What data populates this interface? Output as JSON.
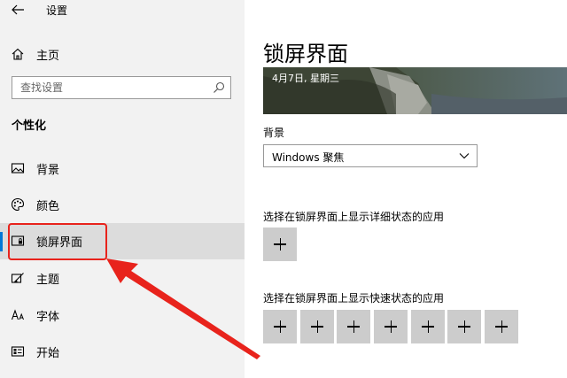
{
  "window": {
    "title": "设置"
  },
  "sidebar": {
    "home_label": "主页",
    "search_placeholder": "查找设置",
    "section_title": "个性化",
    "items": [
      {
        "label": "背景",
        "icon": "image-icon"
      },
      {
        "label": "颜色",
        "icon": "palette-icon"
      },
      {
        "label": "锁屏界面",
        "icon": "lock-screen-icon",
        "active": true
      },
      {
        "label": "主题",
        "icon": "theme-brush-icon"
      },
      {
        "label": "字体",
        "icon": "font-icon"
      },
      {
        "label": "开始",
        "icon": "start-menu-icon"
      }
    ]
  },
  "main": {
    "title": "锁屏界面",
    "preview_date": "4月7日, 星期三",
    "background_label": "背景",
    "background_value": "Windows 聚焦",
    "detail_label": "选择在锁屏界面上显示详细状态的应用",
    "quick_label": "选择在锁屏界面上显示快速状态的应用",
    "quick_slot_count": 7
  },
  "colors": {
    "accent": "#0078d7",
    "annotation": "#e8231c",
    "sidebar_bg": "#f2f2f2"
  }
}
